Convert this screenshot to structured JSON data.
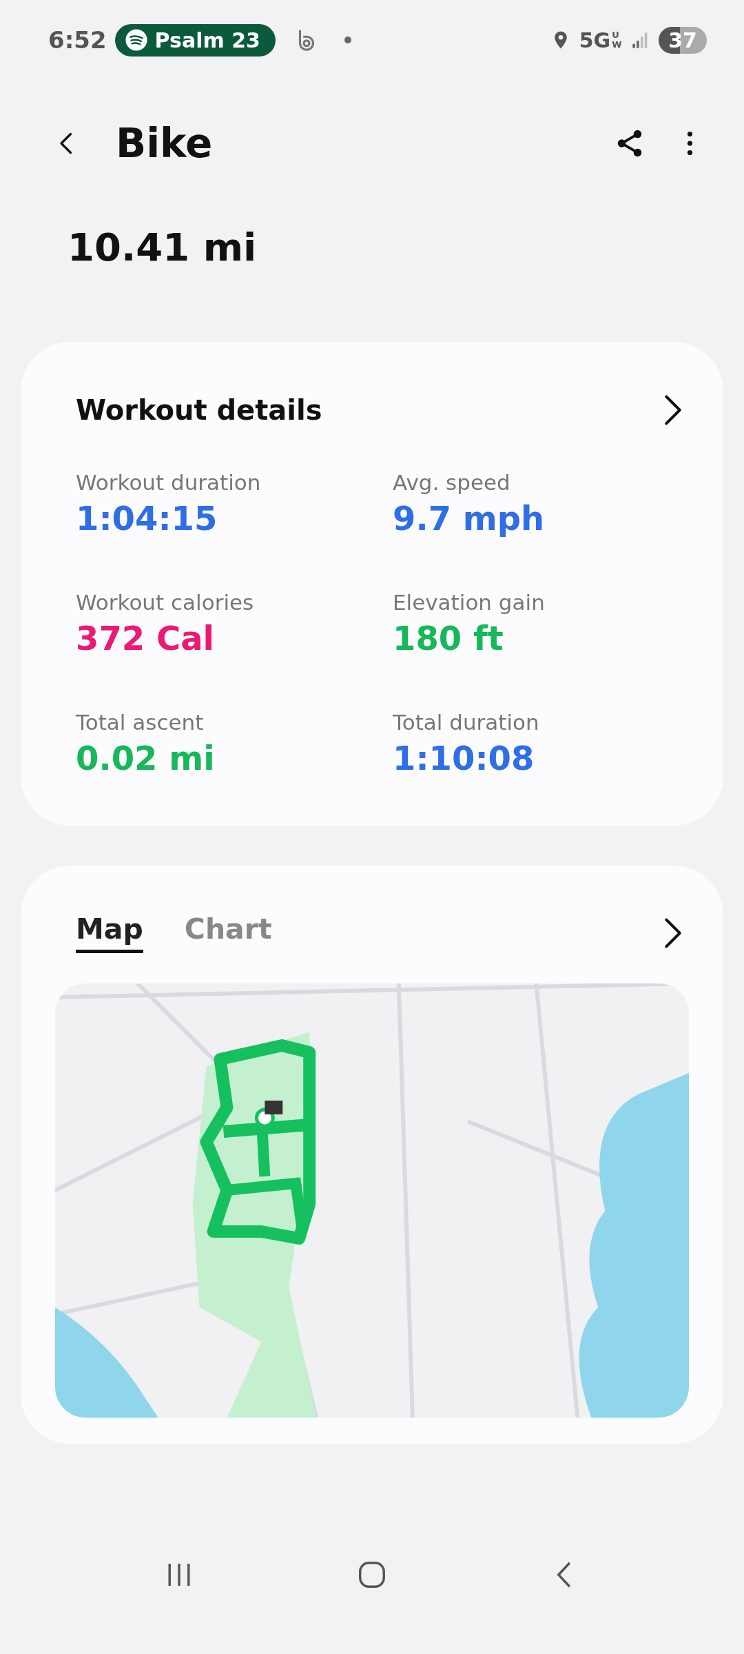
{
  "status_bar": {
    "time": "6:52",
    "media_pill": "Psalm 23",
    "network": "5G",
    "network_sub": "UW",
    "battery": "37"
  },
  "header": {
    "title": "Bike"
  },
  "distance": "10.41 mi",
  "workout_details": {
    "title": "Workout details",
    "metrics": [
      {
        "label": "Workout duration",
        "value": "1:04:15",
        "color": "#2f6ee6"
      },
      {
        "label": "Avg. speed",
        "value": "9.7 mph",
        "color": "#2f6ee6"
      },
      {
        "label": "Workout calories",
        "value": "372 Cal",
        "color": "#ea1a74"
      },
      {
        "label": "Elevation gain",
        "value": "180 ft",
        "color": "#16b85a"
      },
      {
        "label": "Total ascent",
        "value": "0.02 mi",
        "color": "#16b85a"
      },
      {
        "label": "Total duration",
        "value": "1:10:08",
        "color": "#2f6ee6"
      }
    ]
  },
  "route_card": {
    "tabs": [
      {
        "label": "Map",
        "selected": true
      },
      {
        "label": "Chart",
        "selected": false
      }
    ]
  }
}
